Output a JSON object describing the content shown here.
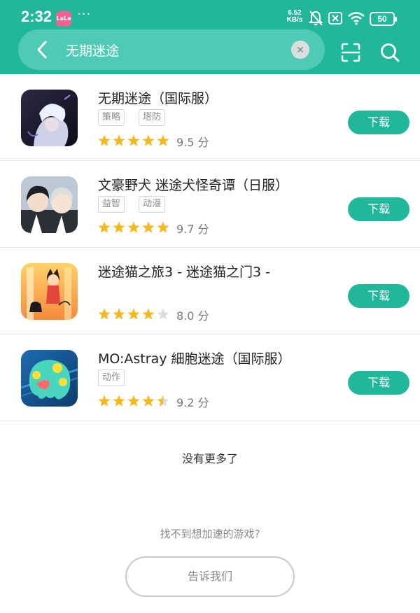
{
  "status_bar": {
    "time": "2:32",
    "app_badge": "LaLa",
    "dots": "···",
    "net_speed_value": "6.52",
    "net_speed_unit": "KB/s",
    "battery": "50"
  },
  "search": {
    "query": "无期迷途"
  },
  "results": [
    {
      "title": "无期迷途（国际服）",
      "tags": [
        "策略",
        "塔防"
      ],
      "score_text": "9.5 分",
      "stars": 5,
      "download_label": "下载"
    },
    {
      "title": "文豪野犬 迷途犬怪奇谭（日服）",
      "tags": [
        "益智",
        "动漫"
      ],
      "score_text": "9.7 分",
      "stars": 5,
      "download_label": "下载"
    },
    {
      "title": "迷途猫之旅3 - 迷途猫之门3 -",
      "tags": [],
      "score_text": "8.0 分",
      "stars": 4,
      "download_label": "下载"
    },
    {
      "title": "MO:Astray 細胞迷途（国际服）",
      "tags": [
        "动作"
      ],
      "score_text": "9.2 分",
      "stars": 4.5,
      "download_label": "下载"
    }
  ],
  "footer": {
    "no_more": "没有更多了",
    "hint": "找不到想加速的游戏?",
    "tell_us": "告诉我们"
  },
  "colors": {
    "accent": "#20b79b",
    "star": "#f5b91e",
    "star_empty": "#dcdcdc"
  }
}
